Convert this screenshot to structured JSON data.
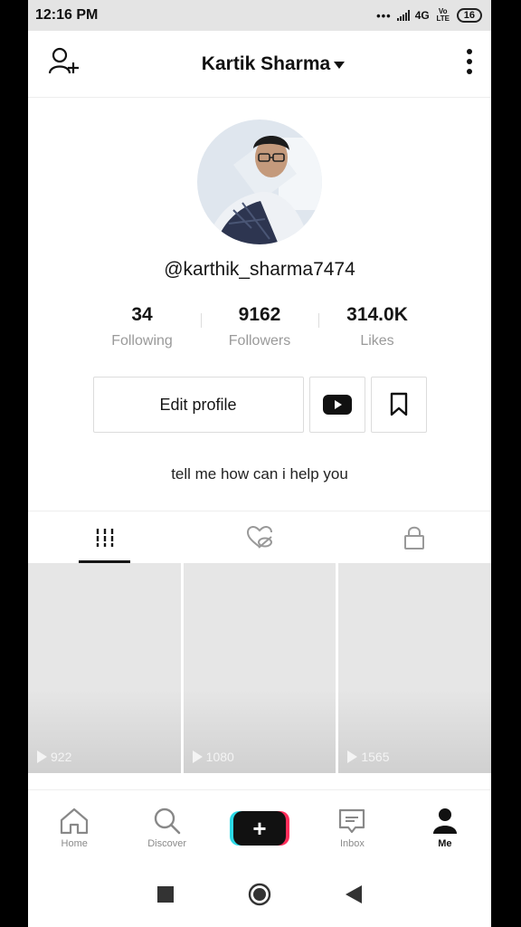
{
  "status": {
    "time": "12:16 PM",
    "network": "4G",
    "volte": "Vo LTE",
    "battery": "16"
  },
  "header": {
    "title": "Kartik Sharma"
  },
  "profile": {
    "handle": "@karthik_sharma7474",
    "stats": [
      {
        "value": "34",
        "label": "Following"
      },
      {
        "value": "9162",
        "label": "Followers"
      },
      {
        "value": "314.0K",
        "label": "Likes"
      }
    ],
    "edit_label": "Edit profile",
    "bio": "tell me how can i help you"
  },
  "videos": [
    {
      "views": "922"
    },
    {
      "views": "1080"
    },
    {
      "views": "1565"
    }
  ],
  "nav": {
    "home": "Home",
    "discover": "Discover",
    "create": "+",
    "inbox": "Inbox",
    "me": "Me"
  }
}
